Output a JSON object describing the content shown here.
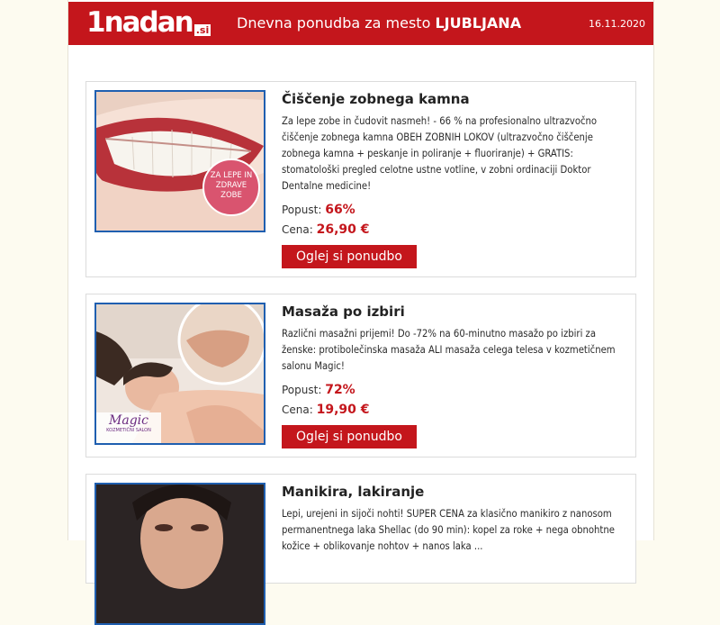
{
  "header": {
    "logo_main": "1nadan",
    "logo_tld": ".si",
    "title_prefix": "Dnevna ponudba za mesto ",
    "city": "LJUBLJANA",
    "date": "16.11.2020"
  },
  "offers": [
    {
      "title": "Čiščenje zobnega kamna",
      "description": "Za lepe zobe in čudovit nasmeh! - 66 % na profesionalno ultrazvočno čiščenje zobnega kamna OBEH ZOBNIH LOKOV (ultrazvočno čiščenje zobnega kamna + peskanje in poliranje + fluoriranje) + GRATIS: stomatološki pregled celotne ustne votline, v zobni ordinaciji Doktor Dentalne medicine!",
      "discount_label": "Popust:",
      "discount": "66%",
      "price_label": "Cena:",
      "price": "26,90 €",
      "button": "Oglej si ponudbo",
      "badge_text": "ZA LEPE IN ZDRAVE ZOBE"
    },
    {
      "title": "Masaža po izbiri",
      "description": "Različni masažni prijemi! Do -72% na 60-minutno masažo po izbiri za ženske: protibolečinska masaža ALI masaža celega telesa v kozmetičnem salonu Magic!",
      "discount_label": "Popust:",
      "discount": "72%",
      "price_label": "Cena:",
      "price": "19,90 €",
      "button": "Oglej si ponudbo",
      "salon_logo": "Magic",
      "salon_sub": "KOZMETIČNI SALON"
    },
    {
      "title": "Manikira, lakiranje",
      "description": "Lepi, urejeni in sijoči nohti! SUPER CENA za klasično manikiro z nanosom permanentnega laka Shellac (do 90 min): kopel za roke + nega obnohtne kožice + oblikovanje nohtov + nanos laka ..."
    }
  ],
  "colors": {
    "brand_red": "#c4161c",
    "image_border": "#1f5fb0",
    "page_background": "#fdfbf0"
  }
}
